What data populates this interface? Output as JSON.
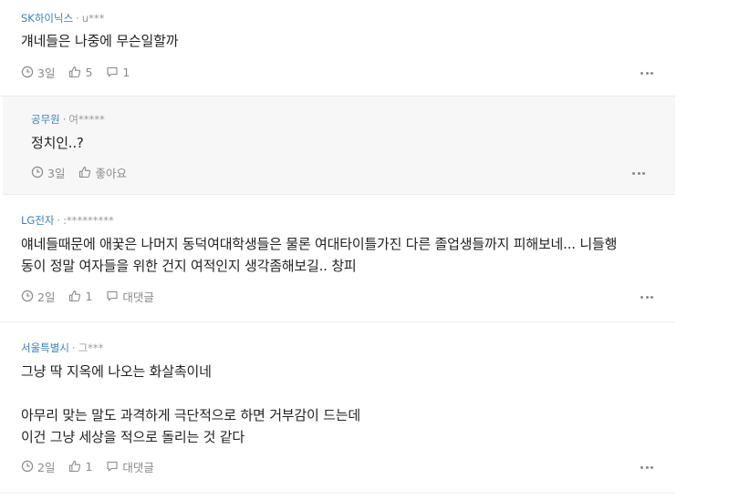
{
  "comments": [
    {
      "company": "SK하이닉스",
      "author": "u***",
      "text": "걔네들은 나중에 무슨일할까",
      "time": "3일",
      "likes": "5",
      "replies": "1"
    },
    {
      "company": "공무원",
      "author": "여*****",
      "text": "정치인..?",
      "time": "3일",
      "likes": "좋아요"
    },
    {
      "company": "LG전자",
      "author": ":*********",
      "text": "얘네들때문에 애꿎은 나머지 동덕여대학생들은 물론 여대타이틀가진 다른 졸업생들까지 피해보네... 니들행\n동이 정말 여자들을 위한 건지 여적인지 생각좀해보길.. 창피",
      "time": "2일",
      "likes": "1",
      "replies": "대댓글"
    },
    {
      "company": "서울특별시",
      "author": "그***",
      "text": "그냥 딱 지옥에 나오는 화살촉이네\n\n아무리 맞는 말도 과격하게 극단적으로 하면 거부감이 드는데\n이건 그냥 세상을 적으로 돌리는 것 같다",
      "time": "2일",
      "likes": "1",
      "replies": "대댓글"
    }
  ],
  "separator": "·"
}
